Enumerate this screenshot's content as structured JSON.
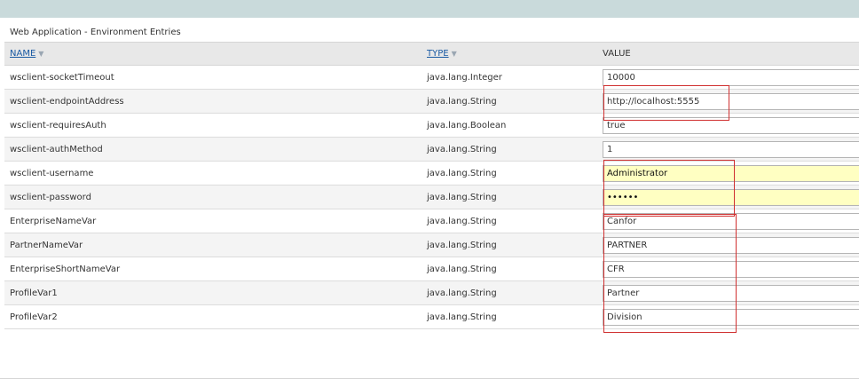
{
  "panel": {
    "title": "Web Application - Environment Entries"
  },
  "table": {
    "columns": {
      "name": "NAME",
      "type": "TYPE",
      "value": "VALUE"
    },
    "sort_arrow": "▼",
    "rows": [
      {
        "name": "wsclient-socketTimeout",
        "type": "java.lang.Integer",
        "value": "10000"
      },
      {
        "name": "wsclient-endpointAddress",
        "type": "java.lang.String",
        "value": "http://localhost:5555"
      },
      {
        "name": "wsclient-requiresAuth",
        "type": "java.lang.Boolean",
        "value": "true"
      },
      {
        "name": "wsclient-authMethod",
        "type": "java.lang.String",
        "value": "1"
      },
      {
        "name": "wsclient-username",
        "type": "java.lang.String",
        "value": "Administrator"
      },
      {
        "name": "wsclient-password",
        "type": "java.lang.String",
        "value": "••••••"
      },
      {
        "name": "EnterpriseNameVar",
        "type": "java.lang.String",
        "value": "Canfor"
      },
      {
        "name": "PartnerNameVar",
        "type": "java.lang.String",
        "value": "PARTNER"
      },
      {
        "name": "EnterpriseShortNameVar",
        "type": "java.lang.String",
        "value": "CFR"
      },
      {
        "name": "ProfileVar1",
        "type": "java.lang.String",
        "value": "Partner"
      },
      {
        "name": "ProfileVar2",
        "type": "java.lang.String",
        "value": "Division"
      }
    ]
  },
  "colors": {
    "top_band": "#c9dadb",
    "header_bg": "#e8e8e8",
    "link": "#1a5aa3",
    "autofill_yellow": "#ffffc2",
    "highlight_box": "#d03030"
  }
}
